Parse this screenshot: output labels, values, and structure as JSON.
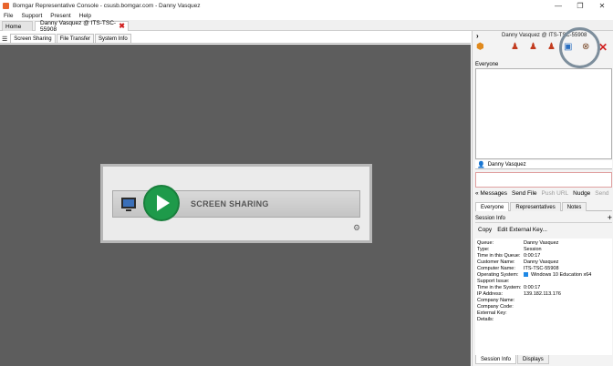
{
  "window": {
    "title": "Bomgar Representative Console - csusb.bomgar.com - Danny Vasquez",
    "minimize": "—",
    "maximize": "❐",
    "close": "✕"
  },
  "menu": [
    "File",
    "Support",
    "Present",
    "Help"
  ],
  "tabs": {
    "home": "Home",
    "session": "Danny Vasquez @ ITS-TSC-55908",
    "session_close": "✖"
  },
  "subtabs": [
    "Screen Sharing",
    "File Transfer",
    "System Info"
  ],
  "screen_sharing": {
    "label": "SCREEN SHARING",
    "gear": "⚙"
  },
  "right_panel": {
    "chevron": "›",
    "title": "Danny Vasquez @ ITS-TSC-55908",
    "everyone_label": "Everyone",
    "user": "Danny Vasquez",
    "chat_actions": [
      "« Messages",
      "Send File",
      "Push URL",
      "Nudge",
      "Send"
    ],
    "chat_tabs": [
      "Everyone",
      "Representatives",
      "Notes"
    ],
    "session_info_label": "Session Info",
    "session_info_plus": "+",
    "session_actions": [
      "Copy",
      "Edit External Key..."
    ],
    "session_info": [
      {
        "key": "Queue:",
        "value": "Danny Vasquez"
      },
      {
        "key": "Type:",
        "value": "Session"
      },
      {
        "key": "Time in this Queue:",
        "value": "0:00:17"
      },
      {
        "key": "Customer Name:",
        "value": "Danny Vasquez"
      },
      {
        "key": "Computer Name:",
        "value": "ITS-TSC-55908"
      },
      {
        "key": "Operating System:",
        "value": "Windows 10 Education x64"
      },
      {
        "key": "Support Issue:",
        "value": ""
      },
      {
        "key": "Time in the System:",
        "value": "0:00:17"
      },
      {
        "key": "IP Address:",
        "value": "139.182.113.176"
      },
      {
        "key": "Company Name:",
        "value": ""
      },
      {
        "key": "Company Code:",
        "value": ""
      },
      {
        "key": "External Key:",
        "value": ""
      },
      {
        "key": "Details:",
        "value": ""
      }
    ],
    "bottom_tabs": [
      "Session Info",
      "Displays"
    ]
  }
}
